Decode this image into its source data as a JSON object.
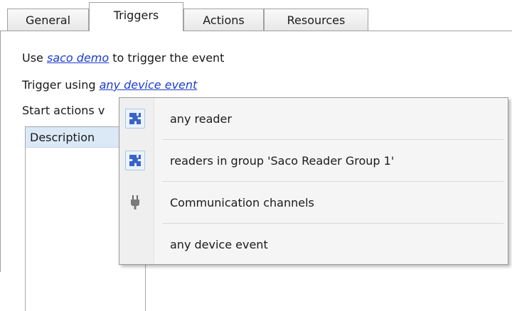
{
  "tabs": [
    {
      "label": "General"
    },
    {
      "label": "Triggers"
    },
    {
      "label": "Actions"
    },
    {
      "label": "Resources"
    }
  ],
  "active_tab": "Triggers",
  "use_line": {
    "prefix": "Use",
    "link": "saco demo",
    "suffix": "to trigger the event"
  },
  "trigger_line": {
    "prefix": "Trigger using",
    "link": "any device event"
  },
  "start_line": {
    "prefix": "Start actions v"
  },
  "description_header": "Description",
  "menu": {
    "items": [
      {
        "label": "any reader",
        "icon": "puzzle-icon"
      },
      {
        "label": "readers in group 'Saco Reader Group 1'",
        "icon": "puzzle-icon"
      },
      {
        "label": "Communication channels",
        "icon": "plug-icon"
      },
      {
        "label": "any device event",
        "icon": ""
      }
    ]
  },
  "colors": {
    "link": "#1b3ccf",
    "header": "#dbe9f7",
    "puzzle": "#3a63c8"
  }
}
